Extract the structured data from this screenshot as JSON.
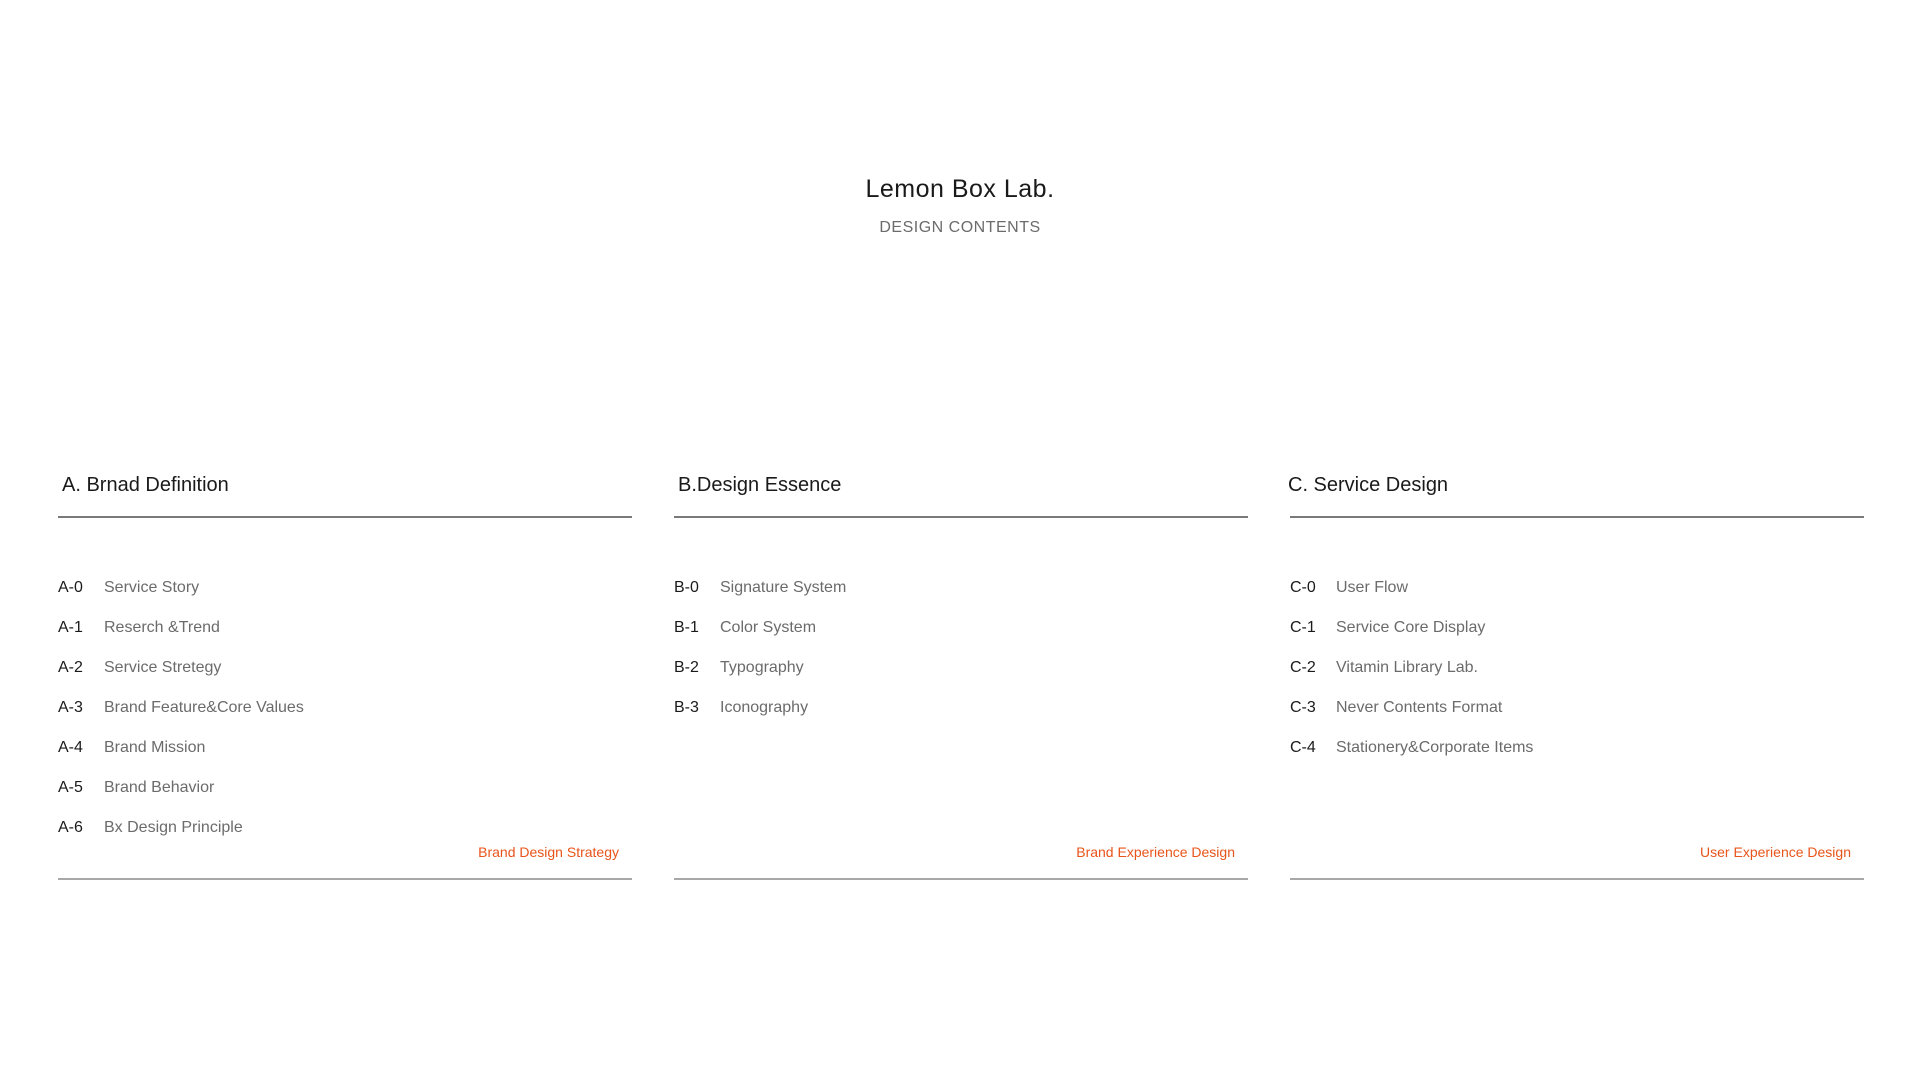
{
  "header": {
    "title": "Lemon Box Lab.",
    "subtitle": "DESIGN CONTENTS"
  },
  "columns": [
    {
      "title": "A. Brnad Definition",
      "items": [
        {
          "code": "A-0",
          "label": "Service Story"
        },
        {
          "code": "A-1",
          "label": "Reserch &Trend"
        },
        {
          "code": "A-2",
          "label": "Service Stretegy"
        },
        {
          "code": "A-3",
          "label": "Brand Feature&Core Values"
        },
        {
          "code": "A-4",
          "label": "Brand Mission"
        },
        {
          "code": "A-5",
          "label": "Brand Behavior"
        },
        {
          "code": "A-6",
          "label": "Bx Design Principle"
        }
      ],
      "footer": "Brand Design Strategy"
    },
    {
      "title": "B.Design Essence",
      "items": [
        {
          "code": "B-0",
          "label": "Signature System"
        },
        {
          "code": "B-1",
          "label": "Color System"
        },
        {
          "code": "B-2",
          "label": "Typography"
        },
        {
          "code": "B-3",
          "label": "Iconography"
        }
      ],
      "footer": "Brand Experience Design"
    },
    {
      "title": "C. Service Design",
      "items": [
        {
          "code": "C-0",
          "label": "User Flow"
        },
        {
          "code": "C-1",
          "label": "Service Core Display"
        },
        {
          "code": "C-2",
          "label": "Vitamin Library Lab."
        },
        {
          "code": "C-3",
          "label": "Never Contents Format"
        },
        {
          "code": "C-4",
          "label": "Stationery&Corporate Items"
        }
      ],
      "footer": "User Experience Design"
    }
  ],
  "colors": {
    "accent": "#e8541a",
    "text": "#1a1a1a",
    "muted": "#6b6b6b",
    "rule": "#7a7a7a"
  }
}
